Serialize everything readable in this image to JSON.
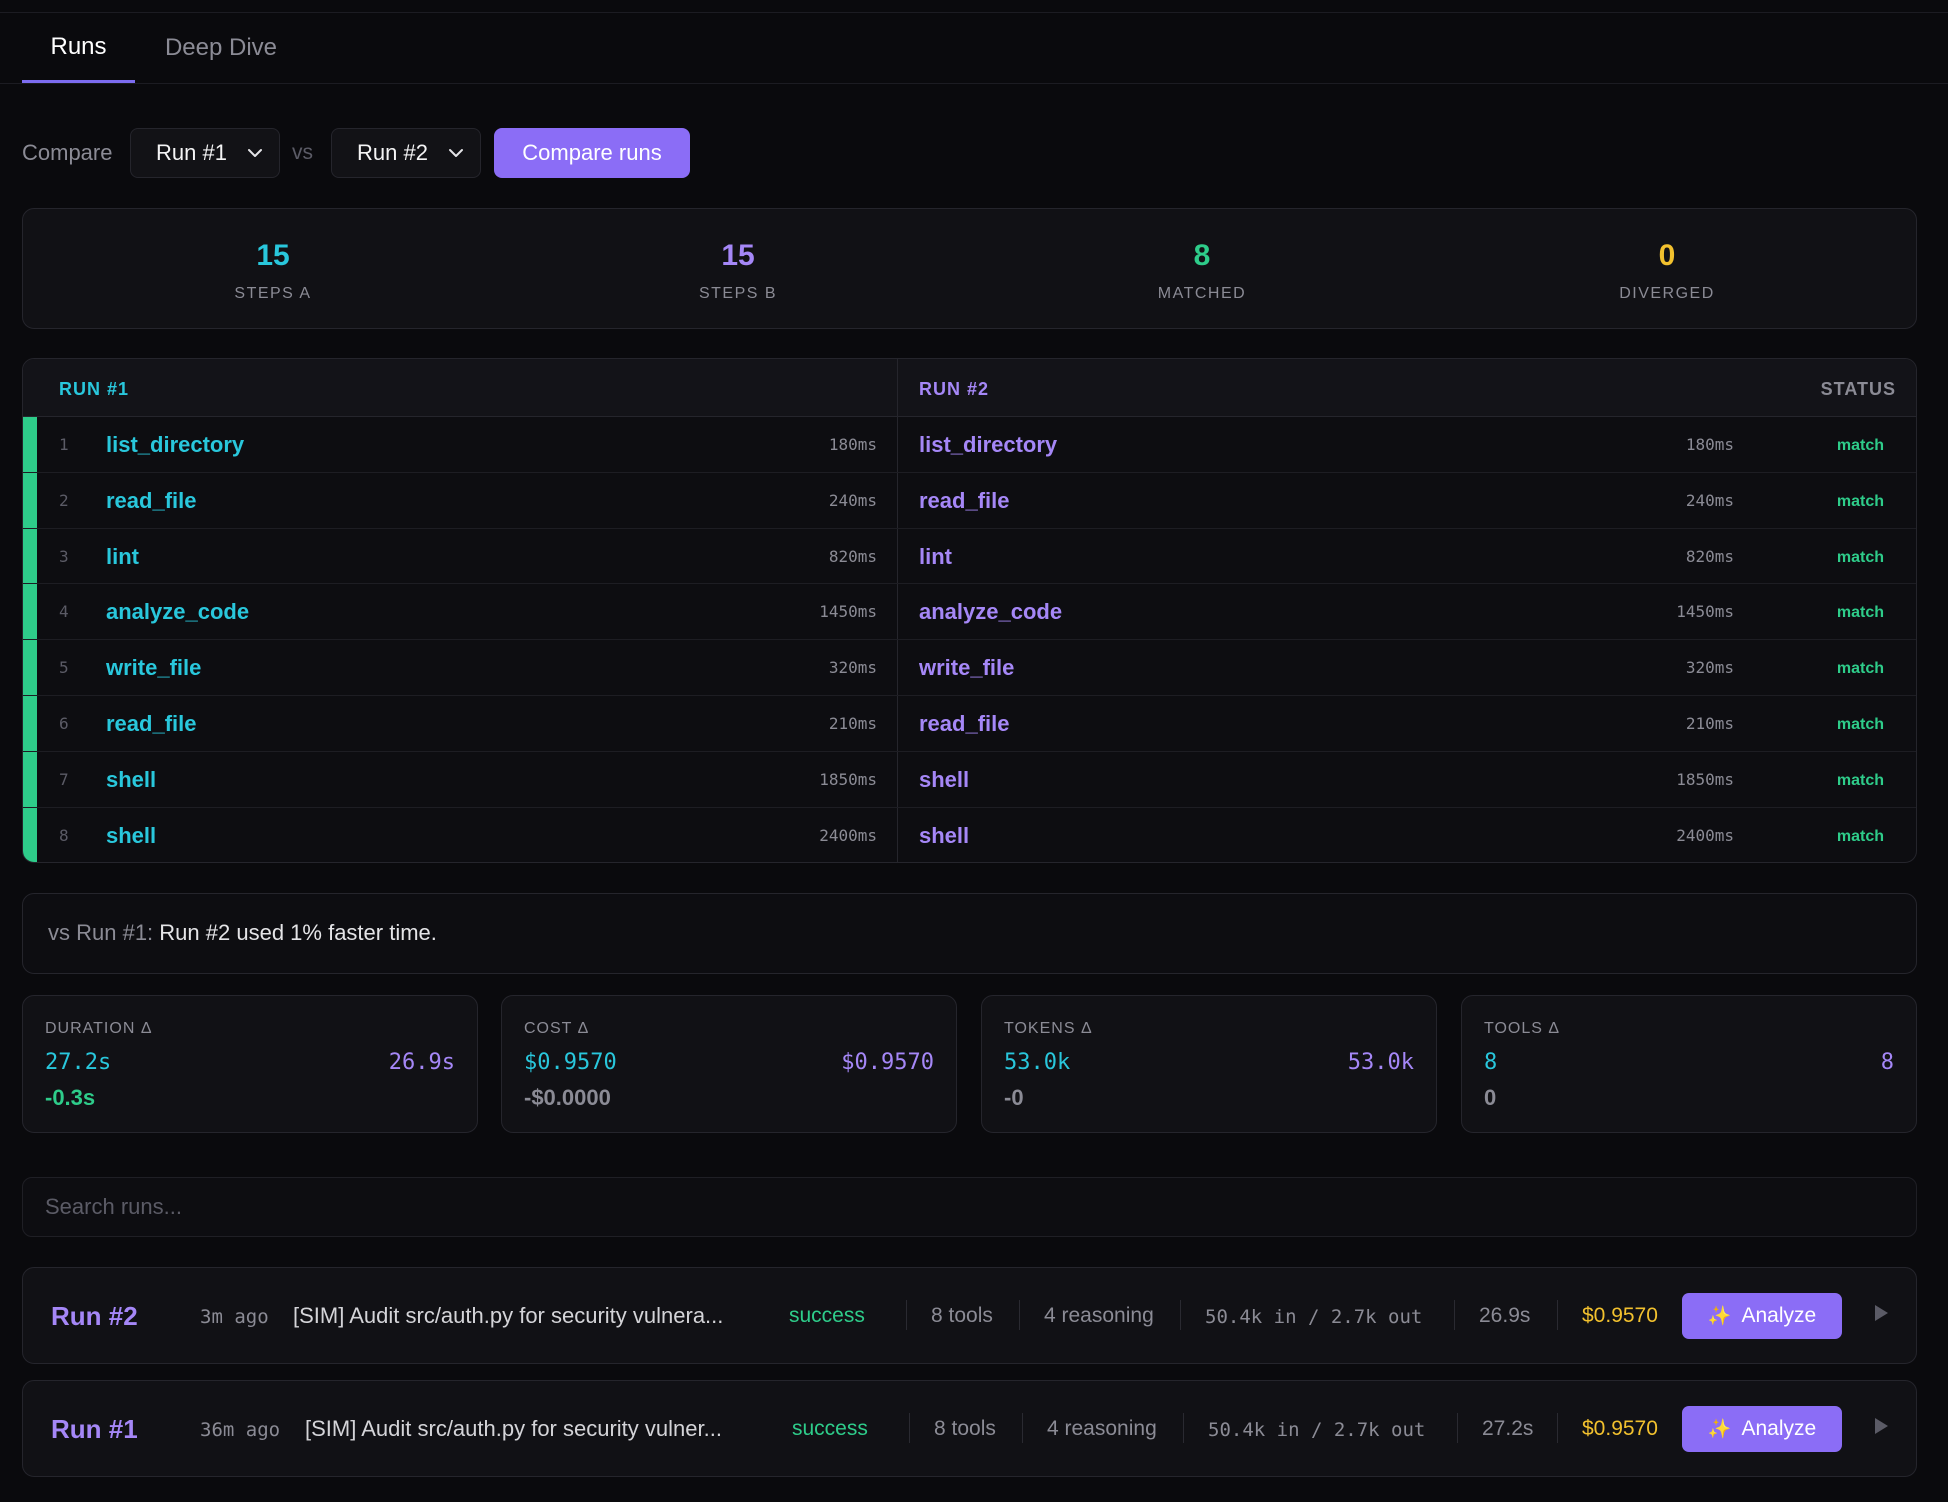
{
  "tabs": [
    {
      "label": "Runs",
      "active": true
    },
    {
      "label": "Deep Dive",
      "active": false
    }
  ],
  "compare": {
    "label": "Compare",
    "run_a": "Run #1",
    "vs": "vs",
    "run_b": "Run #2",
    "button": "Compare runs"
  },
  "stats": [
    {
      "value": "15",
      "label": "STEPS A",
      "color": "#29c7dc"
    },
    {
      "value": "15",
      "label": "STEPS B",
      "color": "#a587f7"
    },
    {
      "value": "8",
      "label": "MATCHED",
      "color": "#2ecc8a"
    },
    {
      "value": "0",
      "label": "DIVERGED",
      "color": "#f2c12e"
    }
  ],
  "steps_table": {
    "header_a": "RUN #1",
    "header_b": "RUN #2",
    "header_status": "STATUS",
    "rows": [
      {
        "n": "1",
        "a_name": "list_directory",
        "a_ms": "180ms",
        "b_name": "list_directory",
        "b_ms": "180ms",
        "status": "match"
      },
      {
        "n": "2",
        "a_name": "read_file",
        "a_ms": "240ms",
        "b_name": "read_file",
        "b_ms": "240ms",
        "status": "match"
      },
      {
        "n": "3",
        "a_name": "lint",
        "a_ms": "820ms",
        "b_name": "lint",
        "b_ms": "820ms",
        "status": "match"
      },
      {
        "n": "4",
        "a_name": "analyze_code",
        "a_ms": "1450ms",
        "b_name": "analyze_code",
        "b_ms": "1450ms",
        "status": "match"
      },
      {
        "n": "5",
        "a_name": "write_file",
        "a_ms": "320ms",
        "b_name": "write_file",
        "b_ms": "320ms",
        "status": "match"
      },
      {
        "n": "6",
        "a_name": "read_file",
        "a_ms": "210ms",
        "b_name": "read_file",
        "b_ms": "210ms",
        "status": "match"
      },
      {
        "n": "7",
        "a_name": "shell",
        "a_ms": "1850ms",
        "b_name": "shell",
        "b_ms": "1850ms",
        "status": "match"
      },
      {
        "n": "8",
        "a_name": "shell",
        "a_ms": "2400ms",
        "b_name": "shell",
        "b_ms": "2400ms",
        "status": "match"
      }
    ]
  },
  "summary": {
    "prefix": "vs Run #1:",
    "text": "Run #2 used 1% faster time."
  },
  "deltas": [
    {
      "label": "DURATION Δ",
      "a": "27.2s",
      "b": "26.9s",
      "delta": "-0.3s",
      "good": true
    },
    {
      "label": "COST Δ",
      "a": "$0.9570",
      "b": "$0.9570",
      "delta": "-$0.0000",
      "good": false
    },
    {
      "label": "TOKENS Δ",
      "a": "53.0k",
      "b": "53.0k",
      "delta": "-0",
      "good": false
    },
    {
      "label": "TOOLS Δ",
      "a": "8",
      "b": "8",
      "delta": "0",
      "good": false
    }
  ],
  "search": {
    "placeholder": "Search runs..."
  },
  "runs": [
    {
      "title": "Run #2",
      "ago": "3m ago",
      "task": "[SIM] Audit src/auth.py for security vulnera...",
      "status": "success",
      "tools": "8 tools",
      "reasoning": "4 reasoning",
      "tokens": "50.4k in / 2.7k out",
      "duration": "26.9s",
      "cost": "$0.9570",
      "analyze": "Analyze"
    },
    {
      "title": "Run #1",
      "ago": "36m ago",
      "task": "[SIM] Audit src/auth.py for security vulner...",
      "status": "success",
      "tools": "8 tools",
      "reasoning": "4 reasoning",
      "tokens": "50.4k in / 2.7k out",
      "duration": "27.2s",
      "cost": "$0.9570",
      "analyze": "Analyze"
    }
  ],
  "colors": {
    "accent": "#8b6df6",
    "run_a": "#29c7dc",
    "run_b": "#a587f7",
    "success": "#2ecc8a",
    "cost": "#f2c12e"
  }
}
